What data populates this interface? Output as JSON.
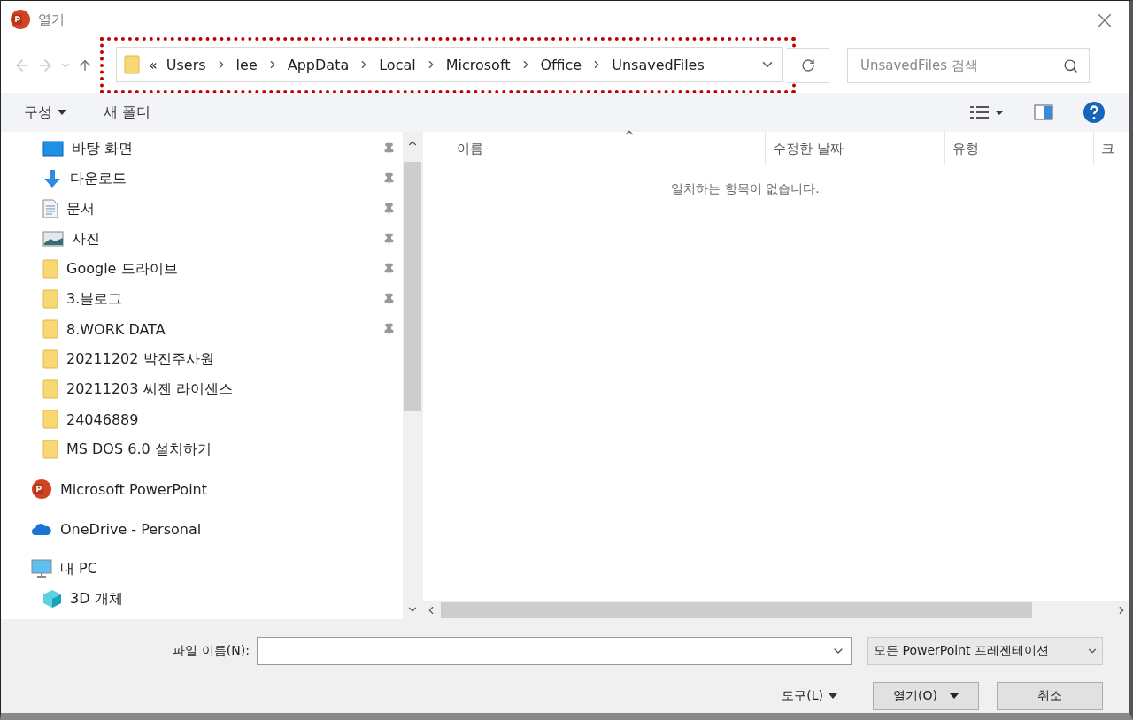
{
  "window": {
    "title": "열기",
    "close": "×"
  },
  "address_bar": {
    "overflow": "«",
    "path": [
      "Users",
      "lee",
      "AppData",
      "Local",
      "Microsoft",
      "Office",
      "UnsavedFiles"
    ],
    "highlighted": true
  },
  "search": {
    "placeholder": "UnsavedFiles 검색"
  },
  "toolbar": {
    "organize": "구성",
    "new_folder": "새 폴더"
  },
  "sidebar": {
    "quick_access_items": [
      {
        "label": "바탕 화면",
        "kind": "desktop",
        "pinned": true
      },
      {
        "label": "다운로드",
        "kind": "download",
        "pinned": true
      },
      {
        "label": "문서",
        "kind": "document",
        "pinned": true
      },
      {
        "label": "사진",
        "kind": "photo",
        "pinned": true
      },
      {
        "label": "Google 드라이브",
        "kind": "folder",
        "pinned": true
      },
      {
        "label": "3.블로그",
        "kind": "folder",
        "pinned": true
      },
      {
        "label": "8.WORK DATA",
        "kind": "folder",
        "pinned": true
      },
      {
        "label": "20211202 박진주사원",
        "kind": "folder",
        "pinned": false
      },
      {
        "label": "20211203 씨젠 라이센스",
        "kind": "folder",
        "pinned": false
      },
      {
        "label": "24046889",
        "kind": "folder",
        "pinned": false
      },
      {
        "label": "MS DOS 6.0 설치하기",
        "kind": "folder",
        "pinned": false
      }
    ],
    "items": [
      {
        "label": "Microsoft PowerPoint",
        "kind": "powerpoint"
      },
      {
        "label": "OneDrive - Personal",
        "kind": "cloud"
      },
      {
        "label": "내 PC",
        "kind": "pc",
        "children": [
          {
            "label": "3D 개체",
            "kind": "cube"
          }
        ]
      }
    ]
  },
  "file_list": {
    "columns": [
      {
        "label": "이름",
        "sorted": true
      },
      {
        "label": "수정한 날짜",
        "sorted": false
      },
      {
        "label": "유형",
        "sorted": false
      },
      {
        "label": "크",
        "sorted": false
      }
    ],
    "empty_message": "일치하는 항목이 없습니다."
  },
  "footer": {
    "file_name_label": "파일 이름(N):",
    "file_type": "모든 PowerPoint 프레젠테이션",
    "tools": "도구(L)",
    "open": "열기(O)",
    "cancel": "취소"
  }
}
